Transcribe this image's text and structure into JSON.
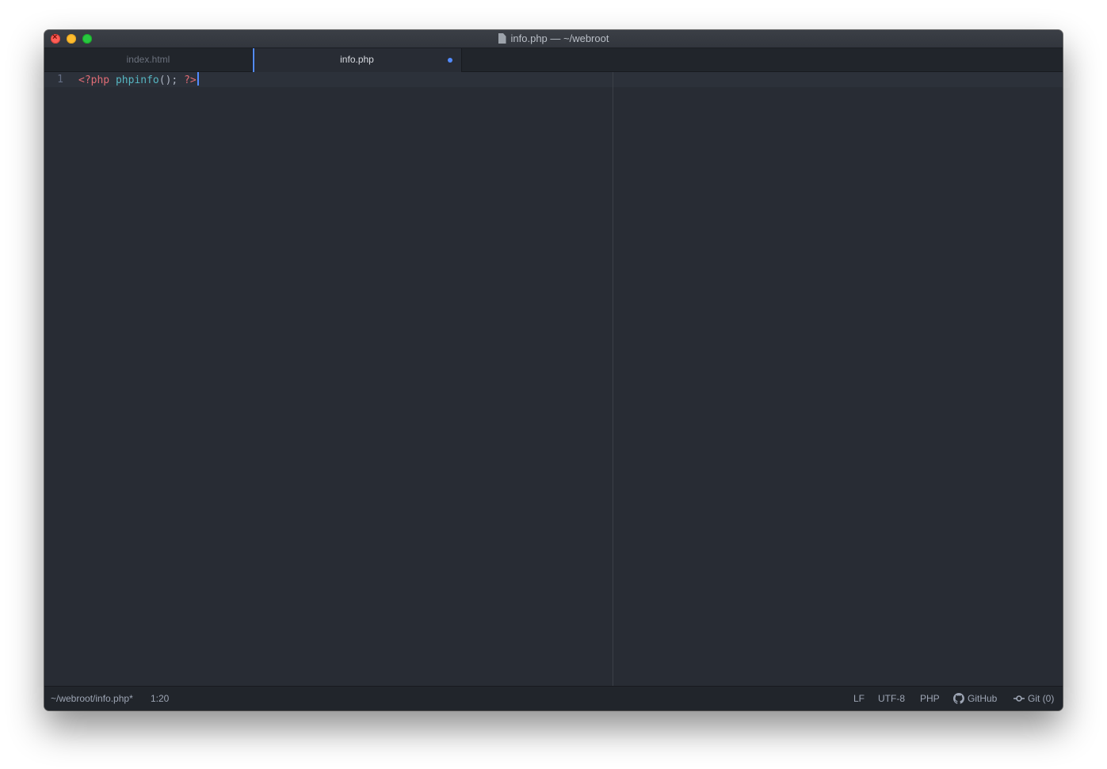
{
  "window": {
    "title": "info.php — ~/webroot"
  },
  "tabs": [
    {
      "label": "index.html",
      "active": false,
      "modified": false
    },
    {
      "label": "info.php",
      "active": true,
      "modified": true
    }
  ],
  "editor": {
    "lines": [
      {
        "number": "1",
        "tokens": {
          "open_tag": "<?php",
          "space1": " ",
          "function": "phpinfo",
          "punctuation": "();",
          "space2": " ",
          "close_tag": "?>"
        }
      }
    ]
  },
  "statusbar": {
    "file_path": "~/webroot/info.php*",
    "cursor_position": "1:20",
    "line_ending": "LF",
    "encoding": "UTF-8",
    "grammar": "PHP",
    "github_label": "GitHub",
    "git_label": "Git (0)"
  },
  "colors": {
    "accent": "#528bff",
    "editor_bg": "#282c34",
    "tag": "#e06c75",
    "function": "#56b6c2"
  }
}
